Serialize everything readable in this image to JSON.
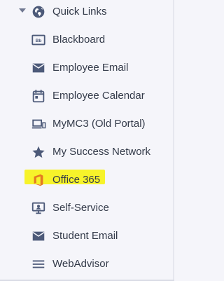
{
  "section": {
    "title": "Quick Links",
    "expanded": true
  },
  "colors": {
    "background": "#f5f5fa",
    "icon": "#4d5a79",
    "text": "#343b4a",
    "highlight": "#f7f32a",
    "office_icon": "#e47a21"
  },
  "links": [
    {
      "label": "Blackboard",
      "icon": "blackboard-logo-icon"
    },
    {
      "label": "Employee Email",
      "icon": "envelope-icon"
    },
    {
      "label": "Employee Calendar",
      "icon": "calendar-icon"
    },
    {
      "label": "MyMC3 (Old Portal)",
      "icon": "laptop-phone-icon"
    },
    {
      "label": "My Success Network",
      "icon": "star-icon"
    },
    {
      "label": "Office 365",
      "icon": "office-logo-icon",
      "highlighted": true
    },
    {
      "label": "Self-Service",
      "icon": "screen-person-icon"
    },
    {
      "label": "Student Email",
      "icon": "mail-icon"
    },
    {
      "label": "WebAdvisor",
      "icon": "menu-lines-icon"
    }
  ]
}
